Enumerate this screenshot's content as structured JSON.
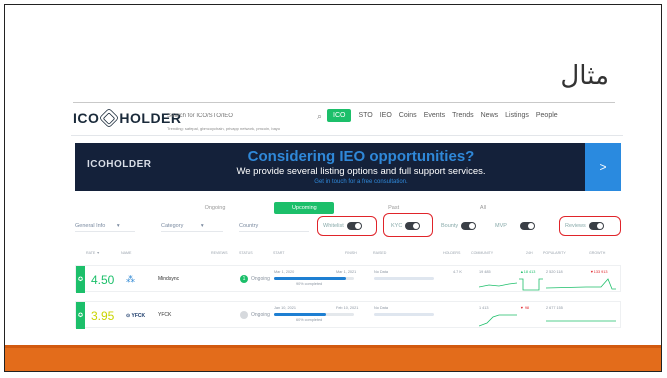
{
  "slide": {
    "title": "مثال",
    "accent_color": "#e36c1b"
  },
  "site": {
    "logo": {
      "left": "ICO",
      "right": "HOLDER"
    },
    "search": {
      "placeholder": "Search for ICO/STO/IEO",
      "icon": "search-icon",
      "trending": "Trending: safepal, gbmcoychain, privapp network, pmcoin, bayo"
    },
    "nav": {
      "items": [
        {
          "label": "ICO",
          "active": true
        },
        {
          "label": "STO",
          "active": false
        },
        {
          "label": "IEO",
          "active": false
        },
        {
          "label": "Coins",
          "active": false
        },
        {
          "label": "Events",
          "active": false
        },
        {
          "label": "Trends",
          "active": false
        },
        {
          "label": "News",
          "active": false
        },
        {
          "label": "Listings",
          "active": false
        },
        {
          "label": "People",
          "active": false
        }
      ]
    },
    "banner": {
      "logo": "ICOHOLDER",
      "title": "Considering IEO opportunities?",
      "subtitle": "We provide several listing options and full support services.",
      "contact": "Get in touch for a free consultation.",
      "arrow": ">"
    },
    "status_tabs": [
      {
        "label": "Ongoing",
        "active": false
      },
      {
        "label": "Upcoming",
        "active": true
      },
      {
        "label": "Past",
        "active": false
      },
      {
        "label": "All",
        "active": false
      }
    ],
    "filters": {
      "general_info": "General Info",
      "category": "Category",
      "country": "Country",
      "whitelist": "Whitelist",
      "kyc": "KYC",
      "bounty": "Bounty",
      "mvp": "MVP",
      "reviews": "Reviews",
      "caret": "▾"
    },
    "table": {
      "headers": {
        "rate": "RATE ▼",
        "name": "NAME",
        "reviews": "REVIEWS",
        "status": "STATUS",
        "start": "START",
        "finish": "FINISH",
        "raised": "RAISED",
        "holders": "HOLDERS",
        "community": "COMMUNITY",
        "day": "24H",
        "popularity": "POPULARITY",
        "growth": "GROWTH"
      },
      "rows": [
        {
          "rate": "4.50",
          "rate_color": "#1cbf6a",
          "logo": "Mindsync logo",
          "name": "Mindsync",
          "reviews": "1",
          "review_color": "#1cbf6a",
          "status": "Ongoing",
          "start": "Mar 1, 2020",
          "finish": "Mar 1, 2021",
          "progress_percent": 90,
          "progress_label": "90% completed",
          "raised": "No Data",
          "holders": "4.7 K",
          "community": "19 485",
          "day": "▲18 413",
          "day_color": "#1cbf6a",
          "popularity": "2 520 118",
          "growth": "▼133 913"
        },
        {
          "rate": "3.95",
          "rate_color": "#c9d400",
          "logo": "YFCK",
          "name": "YFCK",
          "reviews": "",
          "review_color": "#d6d9dd",
          "status": "Ongoing",
          "start": "Jan 10, 2021",
          "finish": "Feb 10, 2021",
          "progress_percent": 65,
          "progress_label": "60% completed",
          "raised": "No Data",
          "holders": "",
          "community": "1 413",
          "day": "▼ 98",
          "day_color": "#e0242a",
          "popularity": "2 677 155",
          "growth": ""
        }
      ]
    },
    "annotation_color": "#e0242a"
  }
}
